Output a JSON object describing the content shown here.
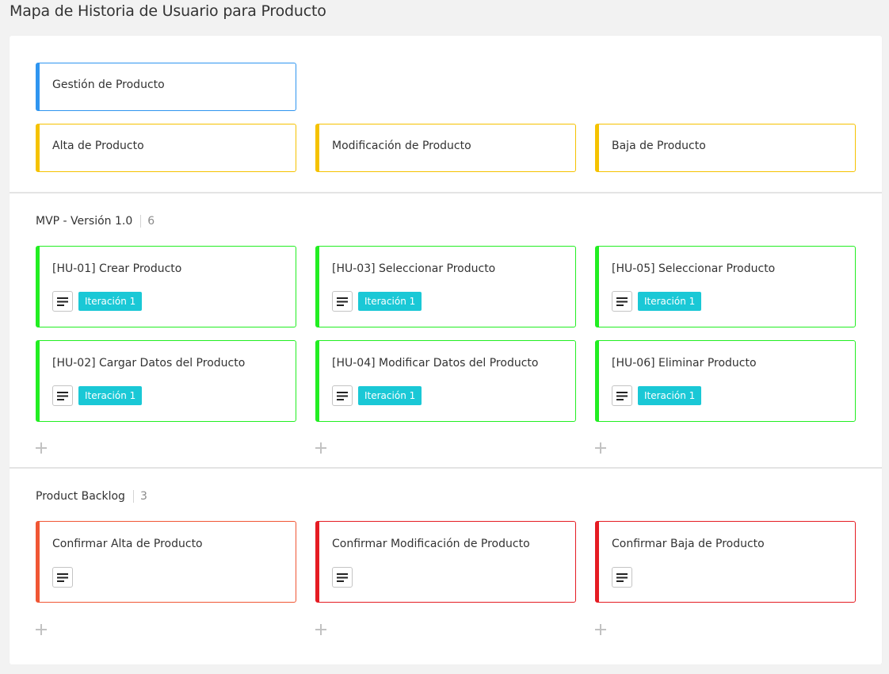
{
  "page": {
    "title": "Mapa de Historia de Usuario para Producto"
  },
  "colors": {
    "epic": "#2f95f0",
    "feature": "#f5c200",
    "mvp": "#22ee22",
    "backlog_first": "#f05634",
    "backlog": "#e51c23",
    "badge": "#1ac8d6"
  },
  "epic": {
    "label": "Gestión de Producto"
  },
  "features": [
    {
      "label": "Alta de Producto"
    },
    {
      "label": "Modificación de Producto"
    },
    {
      "label": "Baja de Producto"
    }
  ],
  "releases": [
    {
      "name": "MVP - Versión 1.0",
      "count": "6",
      "stories": [
        {
          "label": "[HU-01] Crear Producto",
          "badge": "Iteración 1"
        },
        {
          "label": "[HU-03] Seleccionar Producto",
          "badge": "Iteración 1"
        },
        {
          "label": "[HU-05] Seleccionar Producto",
          "badge": "Iteración 1"
        },
        {
          "label": "[HU-02] Cargar Datos del Producto",
          "badge": "Iteración 1"
        },
        {
          "label": "[HU-04] Modificar Datos del Producto",
          "badge": "Iteración 1"
        },
        {
          "label": "[HU-06] Eliminar Producto",
          "badge": "Iteración 1"
        }
      ]
    },
    {
      "name": "Product Backlog",
      "count": "3",
      "stories": [
        {
          "label": "Confirmar Alta de Producto"
        },
        {
          "label": "Confirmar Modificación de Producto"
        },
        {
          "label": "Confirmar Baja de Producto"
        }
      ]
    }
  ],
  "icons": {
    "description": "description-lines-icon",
    "add": "plus-icon"
  }
}
